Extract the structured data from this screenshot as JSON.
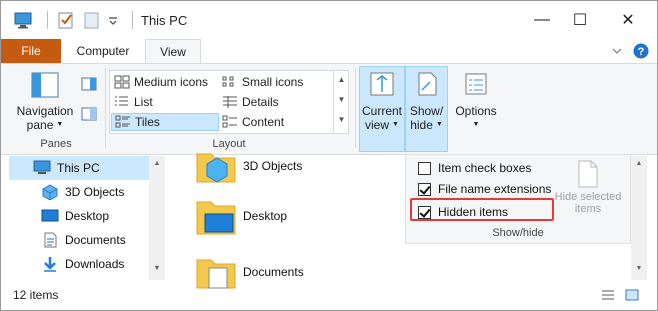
{
  "window": {
    "title": "This PC",
    "controls": {
      "minimize": "—",
      "maximize": "☐",
      "close": "✕"
    }
  },
  "tabs": [
    {
      "label": "File"
    },
    {
      "label": "Computer"
    },
    {
      "label": "View"
    }
  ],
  "ribbon": {
    "panes": {
      "navigation_pane_line1": "Navigation",
      "navigation_pane_line2": "pane",
      "group_label": "Panes"
    },
    "layout": {
      "items": [
        {
          "label": "Medium icons"
        },
        {
          "label": "Small icons"
        },
        {
          "label": "List"
        },
        {
          "label": "Details"
        },
        {
          "label": "Tiles"
        },
        {
          "label": "Content"
        }
      ],
      "group_label": "Layout"
    },
    "current_view": {
      "line1": "Current",
      "line2": "view"
    },
    "show_hide": {
      "line1": "Show/",
      "line2": "hide"
    },
    "options": {
      "label": "Options"
    }
  },
  "show_hide_menu": {
    "item_check_boxes": "Item check boxes",
    "file_name_extensions": "File name extensions",
    "hidden_items": "Hidden items",
    "hide_selected_line1": "Hide selected",
    "hide_selected_line2": "items",
    "group_label": "Show/hide",
    "checked": {
      "item_check_boxes": false,
      "file_name_extensions": true,
      "hidden_items": true
    }
  },
  "nav": {
    "items": [
      {
        "label": "This PC"
      },
      {
        "label": "3D Objects"
      },
      {
        "label": "Desktop"
      },
      {
        "label": "Documents"
      },
      {
        "label": "Downloads"
      }
    ]
  },
  "content": {
    "items": [
      {
        "label": "3D Objects"
      },
      {
        "label": "Desktop"
      },
      {
        "label": "Documents"
      }
    ]
  },
  "status": {
    "count": "12 items"
  },
  "colors": {
    "file_tab": "#c55a11",
    "accent": "#0078d7",
    "highlight": "#cce8ff",
    "callout": "#e23b3b"
  }
}
